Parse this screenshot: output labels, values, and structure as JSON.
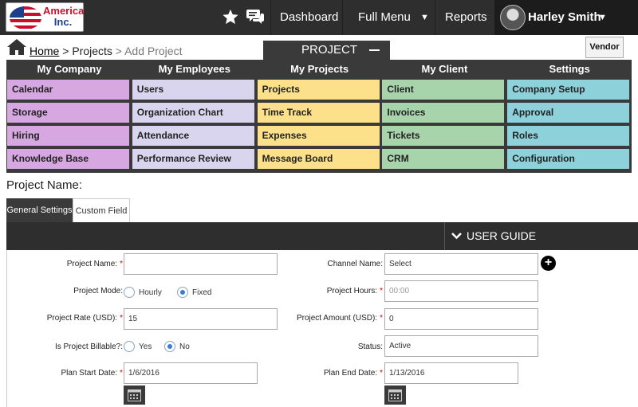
{
  "brand": {
    "line1": "America",
    "line2": "Inc."
  },
  "header": {
    "nav": {
      "dashboard": "Dashboard",
      "full_menu": "Full Menu",
      "reports": "Reports"
    },
    "user_name": "Harley Smith"
  },
  "breadcrumb": {
    "home": "Home",
    "sep1": " > ",
    "projects": "Projects",
    "sep2": " > ",
    "current": "Add Project"
  },
  "project_tab": "PROJECT",
  "vendor_button": "Vendor",
  "menu": {
    "columns": [
      {
        "title": "My Company",
        "color": "#d6a7e0",
        "items": [
          "Calendar",
          "Storage",
          "Hiring",
          "Knowledge Base"
        ]
      },
      {
        "title": "My Employees",
        "color": "#d9d5ef",
        "items": [
          "Users",
          "Organization Chart",
          "Attendance",
          "Performance Review"
        ]
      },
      {
        "title": "My Projects",
        "color": "#fde08a",
        "items": [
          "Projects",
          "Time Track",
          "Expenses",
          "Message Board"
        ]
      },
      {
        "title": "My Client",
        "color": "#a8d4ac",
        "items": [
          "Client",
          "Invoices",
          "Tickets",
          "CRM"
        ]
      },
      {
        "title": "Settings",
        "color": "#8dd1db",
        "items": [
          "Company Setup",
          "Approval",
          "Roles",
          "Configuration"
        ]
      }
    ]
  },
  "page_label": "Project Name:",
  "tabs": {
    "general": "General Settings",
    "custom": "Custom Field"
  },
  "user_guide": "USER GUIDE",
  "form": {
    "project_name": {
      "label": "Project Name:",
      "value": ""
    },
    "channel_name": {
      "label": "Channel Name:",
      "value": "Select"
    },
    "project_mode": {
      "label": "Project Mode:",
      "opt1": "Hourly",
      "opt2": "Fixed",
      "selected": "Fixed"
    },
    "project_hours": {
      "label": "Project Hours:",
      "placeholder": "00:00"
    },
    "project_rate": {
      "label": "Project Rate (USD):",
      "value": "15"
    },
    "project_amount": {
      "label": "Project Amount (USD):",
      "value": "0"
    },
    "billable": {
      "label": "Is Project Billable?:",
      "opt1": "Yes",
      "opt2": "No",
      "selected": "No"
    },
    "status": {
      "label": "Status:",
      "value": "Active"
    },
    "plan_start": {
      "label": "Plan Start Date:",
      "value": "1/6/2016"
    },
    "plan_end": {
      "label": "Plan End Date:",
      "value": "1/13/2016"
    }
  }
}
